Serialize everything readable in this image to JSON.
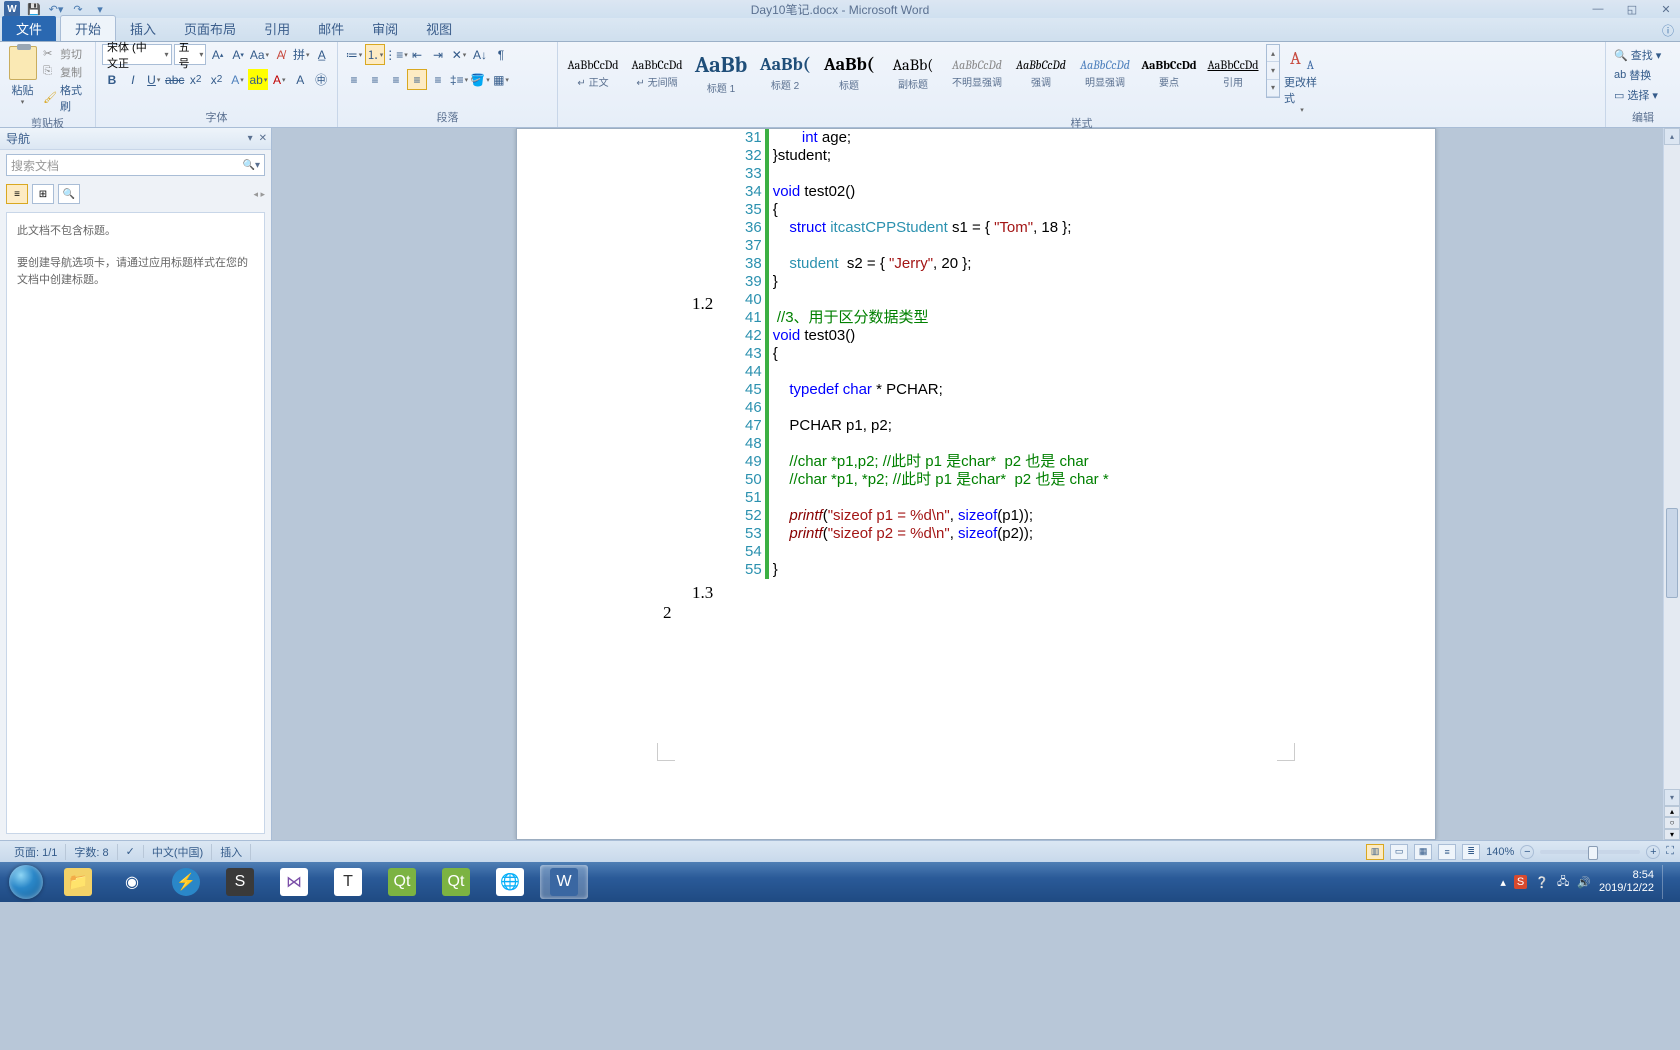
{
  "title": "Day10笔记.docx - Microsoft Word",
  "tabs": {
    "file": "文件",
    "home": "开始",
    "insert": "插入",
    "layout": "页面布局",
    "references": "引用",
    "mailings": "邮件",
    "review": "审阅",
    "view": "视图"
  },
  "clipboard": {
    "paste": "粘贴",
    "cut": "剪切",
    "copy": "复制",
    "painter": "格式刷",
    "group": "剪贴板"
  },
  "font": {
    "name": "宋体 (中文正",
    "size": "五号",
    "group": "字体"
  },
  "paragraph": {
    "group": "段落"
  },
  "styles": {
    "group": "样式",
    "change": "更改样式",
    "items": [
      {
        "preview": "AaBbCcDd",
        "name": "↵ 正文",
        "size": "12px",
        "color": "#000"
      },
      {
        "preview": "AaBbCcDd",
        "name": "↵ 无间隔",
        "size": "12px",
        "color": "#000"
      },
      {
        "preview": "AaBb",
        "name": "标题 1",
        "size": "22px",
        "color": "#1f4e79",
        "bold": true
      },
      {
        "preview": "AaBb(",
        "name": "标题 2",
        "size": "18px",
        "color": "#1f4e79",
        "bold": true
      },
      {
        "preview": "AaBb(",
        "name": "标题",
        "size": "18px",
        "color": "#000",
        "bold": true
      },
      {
        "preview": "AaBb(",
        "name": "副标题",
        "size": "16px",
        "color": "#000"
      },
      {
        "preview": "AaBbCcDd",
        "name": "不明显强调",
        "size": "12px",
        "color": "#8a8a8a",
        "italic": true
      },
      {
        "preview": "AaBbCcDd",
        "name": "强调",
        "size": "12px",
        "color": "#000",
        "italic": true
      },
      {
        "preview": "AaBbCcDd",
        "name": "明显强调",
        "size": "12px",
        "color": "#4f81bd",
        "italic": true
      },
      {
        "preview": "AaBbCcDd",
        "name": "要点",
        "size": "12px",
        "color": "#000",
        "bold": true
      },
      {
        "preview": "AaBbCcDd",
        "name": "引用",
        "size": "12px",
        "color": "#000",
        "under": true
      }
    ]
  },
  "editing": {
    "find": "查找",
    "replace": "替换",
    "select": "选择",
    "group": "编辑"
  },
  "nav": {
    "title": "导航",
    "search_placeholder": "搜索文档",
    "msg1": "此文档不包含标题。",
    "msg2": "要创建导航选项卡，请通过应用标题样式在您的文档中创建标题。"
  },
  "outline": {
    "n1": "1.2",
    "n2": "1.3",
    "n3": "2"
  },
  "code": {
    "start": 31,
    "lines": [
      {
        "t": "       int age;",
        "html": "       <span class='kw'>int</span> age;"
      },
      {
        "t": "}student;",
        "html": "}student;"
      },
      {
        "t": "",
        "html": ""
      },
      {
        "t": "void test02()",
        "html": "<span class='kw'>void</span> test02()"
      },
      {
        "t": "{",
        "html": "{"
      },
      {
        "t": "    struct itcastCPPStudent s1 = { \"Tom\", 18 };",
        "html": "    <span class='kw'>struct</span> <span class='tn'>itcastCPPStudent</span> s1 = { <span class='str'>\"Tom\"</span>, 18 };"
      },
      {
        "t": "",
        "html": ""
      },
      {
        "t": "    student  s2 = { \"Jerry\", 20 };",
        "html": "    <span class='tn'>student</span>  s2 = { <span class='str'>\"Jerry\"</span>, 20 };"
      },
      {
        "t": "}",
        "html": "}"
      },
      {
        "t": "",
        "html": ""
      },
      {
        "t": " //3、用于区分数据类型",
        "html": " <span class='cm'>//3、用于区分数据类型</span>"
      },
      {
        "t": "void test03()",
        "html": "<span class='kw'>void</span> test03()"
      },
      {
        "t": "{",
        "html": "{"
      },
      {
        "t": "",
        "html": ""
      },
      {
        "t": "    typedef char * PCHAR;",
        "html": "    <span class='kw'>typedef</span> <span class='kw'>char</span> * PCHAR;"
      },
      {
        "t": "",
        "html": ""
      },
      {
        "t": "    PCHAR p1, p2;",
        "html": "    PCHAR p1, p2;"
      },
      {
        "t": "",
        "html": ""
      },
      {
        "t": "    //char *p1,p2; //此时 p1 是char*  p2 也是 char",
        "html": "    <span class='cm'>//char *p1,p2; //此时 p1 是char*  p2 也是 char</span>"
      },
      {
        "t": "    //char *p1, *p2; //此时 p1 是char*  p2 也是 char *",
        "html": "    <span class='cm'>//char *p1, *p2; //此时 p1 是char*  p2 也是 char *</span>"
      },
      {
        "t": "",
        "html": ""
      },
      {
        "t": "    printf(\"sizeof p1 = %d\\n\", sizeof(p1));",
        "html": "    <span class='fn'>printf</span>(<span class='str'>\"sizeof p1 = %d\\n\"</span>, <span class='kw'>sizeof</span>(p1));"
      },
      {
        "t": "    printf(\"sizeof p2 = %d\\n\", sizeof(p2));",
        "html": "    <span class='fn'>printf</span>(<span class='str'>\"sizeof p2 = %d\\n\"</span>, <span class='kw'>sizeof</span>(p2));"
      },
      {
        "t": "",
        "html": ""
      },
      {
        "t": "}",
        "html": "}"
      }
    ]
  },
  "status": {
    "page": "页面: 1/1",
    "words": "字数: 8",
    "lang": "中文(中国)",
    "mode": "插入",
    "zoom": "140%"
  },
  "tray": {
    "time": "8:54",
    "date": "2019/12/22"
  }
}
